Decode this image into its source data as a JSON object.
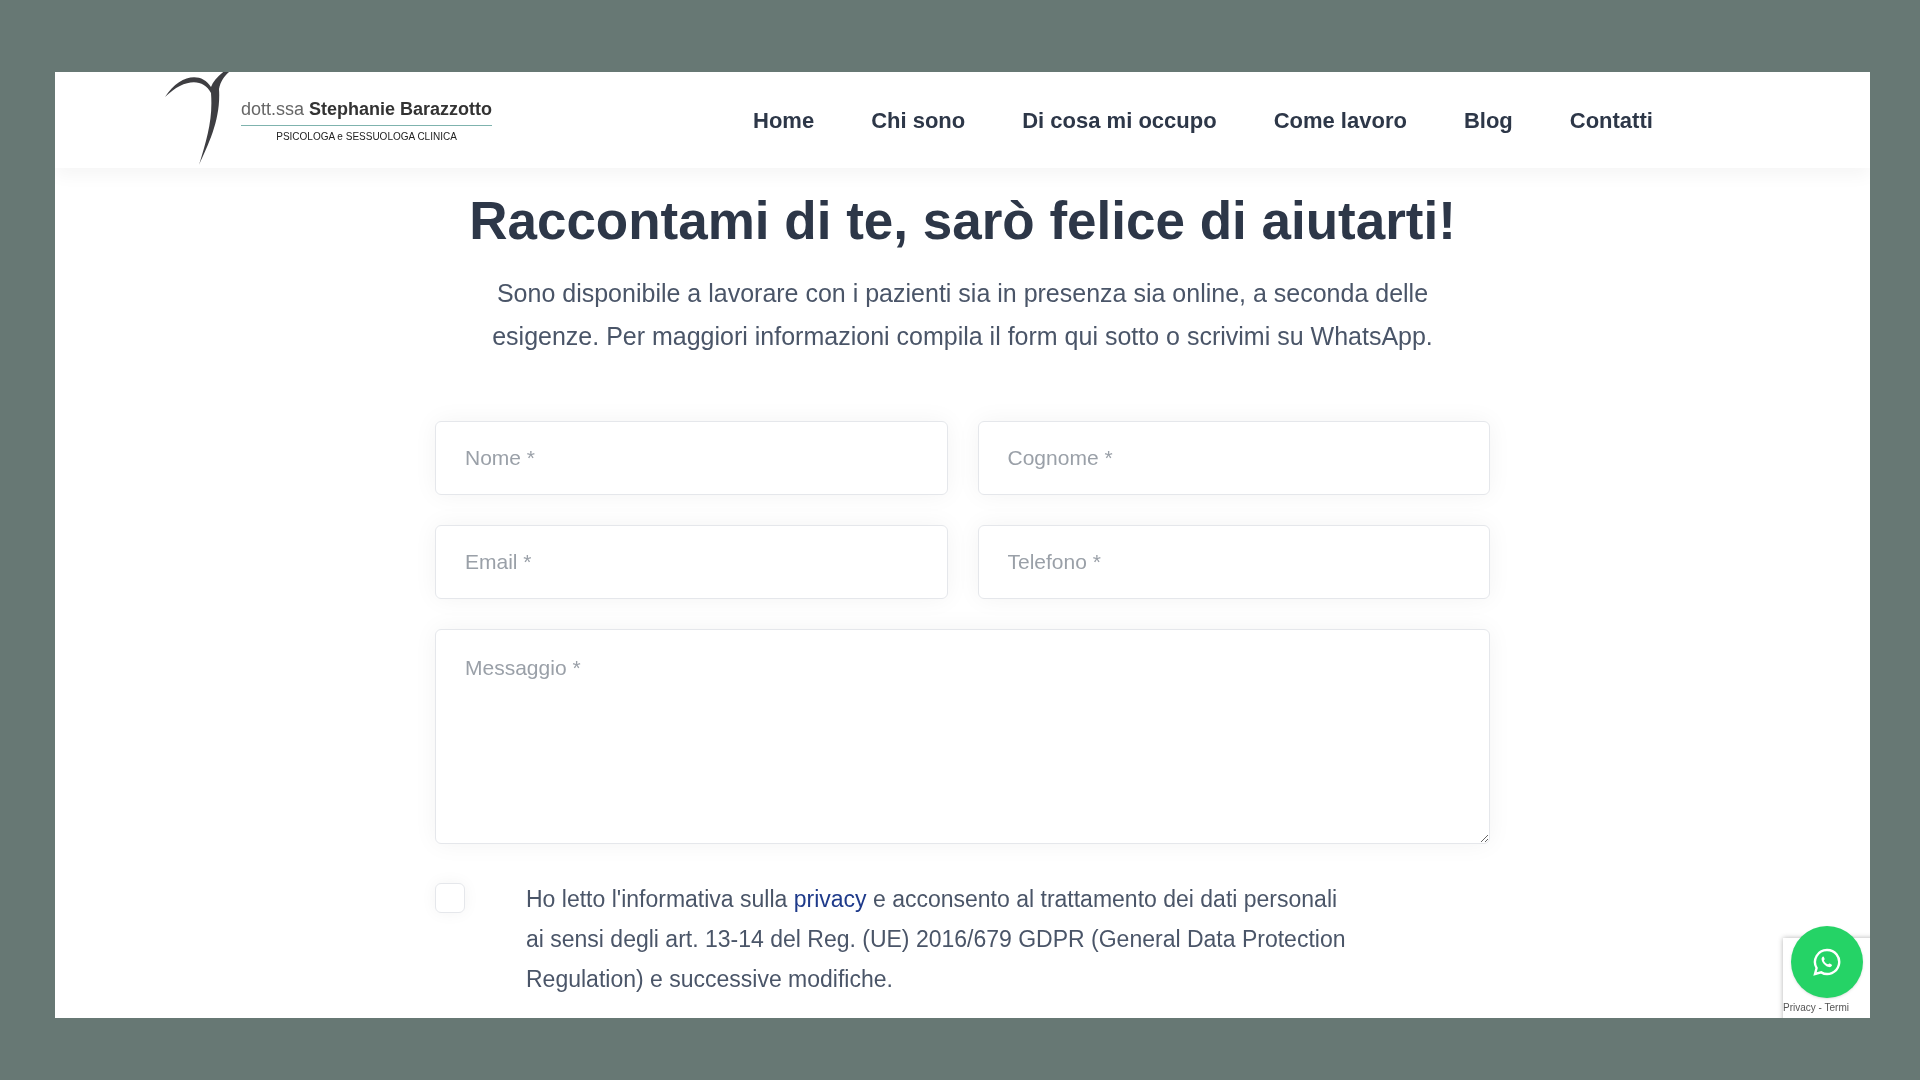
{
  "logo": {
    "prefix": "dott.ssa",
    "name": "Stephanie Barazzotto",
    "tagline": "PSICOLOGA e SESSUOLOGA CLINICA"
  },
  "nav": [
    {
      "label": "Home"
    },
    {
      "label": "Chi sono"
    },
    {
      "label": "Di cosa mi occupo"
    },
    {
      "label": "Come lavoro"
    },
    {
      "label": "Blog"
    },
    {
      "label": "Contatti"
    }
  ],
  "heading": "Raccontami di te, sarò felice di aiutarti!",
  "intro": "Sono disponibile a lavorare con i pazienti sia in presenza sia online, a seconda delle esigenze. Per maggiori informazioni compila il form qui sotto o scrivimi su WhatsApp.",
  "fields": [
    {
      "placeholder": "Nome *"
    },
    {
      "placeholder": "Cognome *"
    },
    {
      "placeholder": "Email *"
    },
    {
      "placeholder": "Telefono *"
    }
  ],
  "message": {
    "placeholder": "Messaggio *"
  },
  "consent": {
    "checked": false,
    "before": "Ho letto l'informativa sulla",
    "link": "privacy",
    "after": "e acconsento al trattamento dei dati personali ai sensi degli art. 13-14 del Reg. (UE) 2016/679 GDPR (General Data Protection Regulation) e successive modifiche."
  },
  "recaptcha": {
    "text": "Privacy - Termi"
  }
}
